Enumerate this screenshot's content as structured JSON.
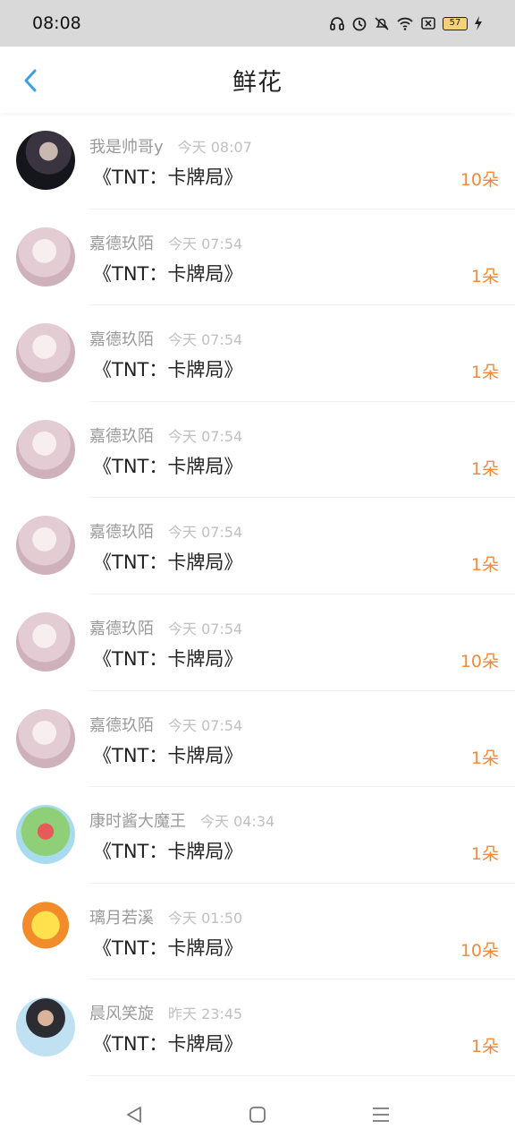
{
  "status_bar": {
    "time": "08:08",
    "battery": "57"
  },
  "header": {
    "title": "鲜花"
  },
  "items": [
    {
      "name": "我是帅哥y",
      "time": "今天 08:07",
      "book": "《TNT：卡牌局》",
      "count": "10朵",
      "avatar": "av-dark"
    },
    {
      "name": "嘉德玖陌",
      "time": "今天 07:54",
      "book": "《TNT：卡牌局》",
      "count": "1朵",
      "avatar": "av-pink"
    },
    {
      "name": "嘉德玖陌",
      "time": "今天 07:54",
      "book": "《TNT：卡牌局》",
      "count": "1朵",
      "avatar": "av-pink"
    },
    {
      "name": "嘉德玖陌",
      "time": "今天 07:54",
      "book": "《TNT：卡牌局》",
      "count": "1朵",
      "avatar": "av-pink"
    },
    {
      "name": "嘉德玖陌",
      "time": "今天 07:54",
      "book": "《TNT：卡牌局》",
      "count": "1朵",
      "avatar": "av-pink"
    },
    {
      "name": "嘉德玖陌",
      "time": "今天 07:54",
      "book": "《TNT：卡牌局》",
      "count": "10朵",
      "avatar": "av-pink"
    },
    {
      "name": "嘉德玖陌",
      "time": "今天 07:54",
      "book": "《TNT：卡牌局》",
      "count": "1朵",
      "avatar": "av-pink"
    },
    {
      "name": "康时酱大魔王",
      "time": "今天 04:34",
      "book": "《TNT：卡牌局》",
      "count": "1朵",
      "avatar": "av-green"
    },
    {
      "name": "璃月若溪",
      "time": "今天 01:50",
      "book": "《TNT：卡牌局》",
      "count": "10朵",
      "avatar": "av-cartoon"
    },
    {
      "name": "晨风笑旋",
      "time": "昨天 23:45",
      "book": "《TNT：卡牌局》",
      "count": "1朵",
      "avatar": "av-person"
    }
  ],
  "icons": {
    "back": "back-arrow-icon",
    "nav_back": "triangle-back-icon",
    "nav_home": "square-home-icon",
    "nav_menu": "menu-lines-icon"
  },
  "colors": {
    "accent": "#3aa0e6",
    "count": "#f08a3c"
  }
}
